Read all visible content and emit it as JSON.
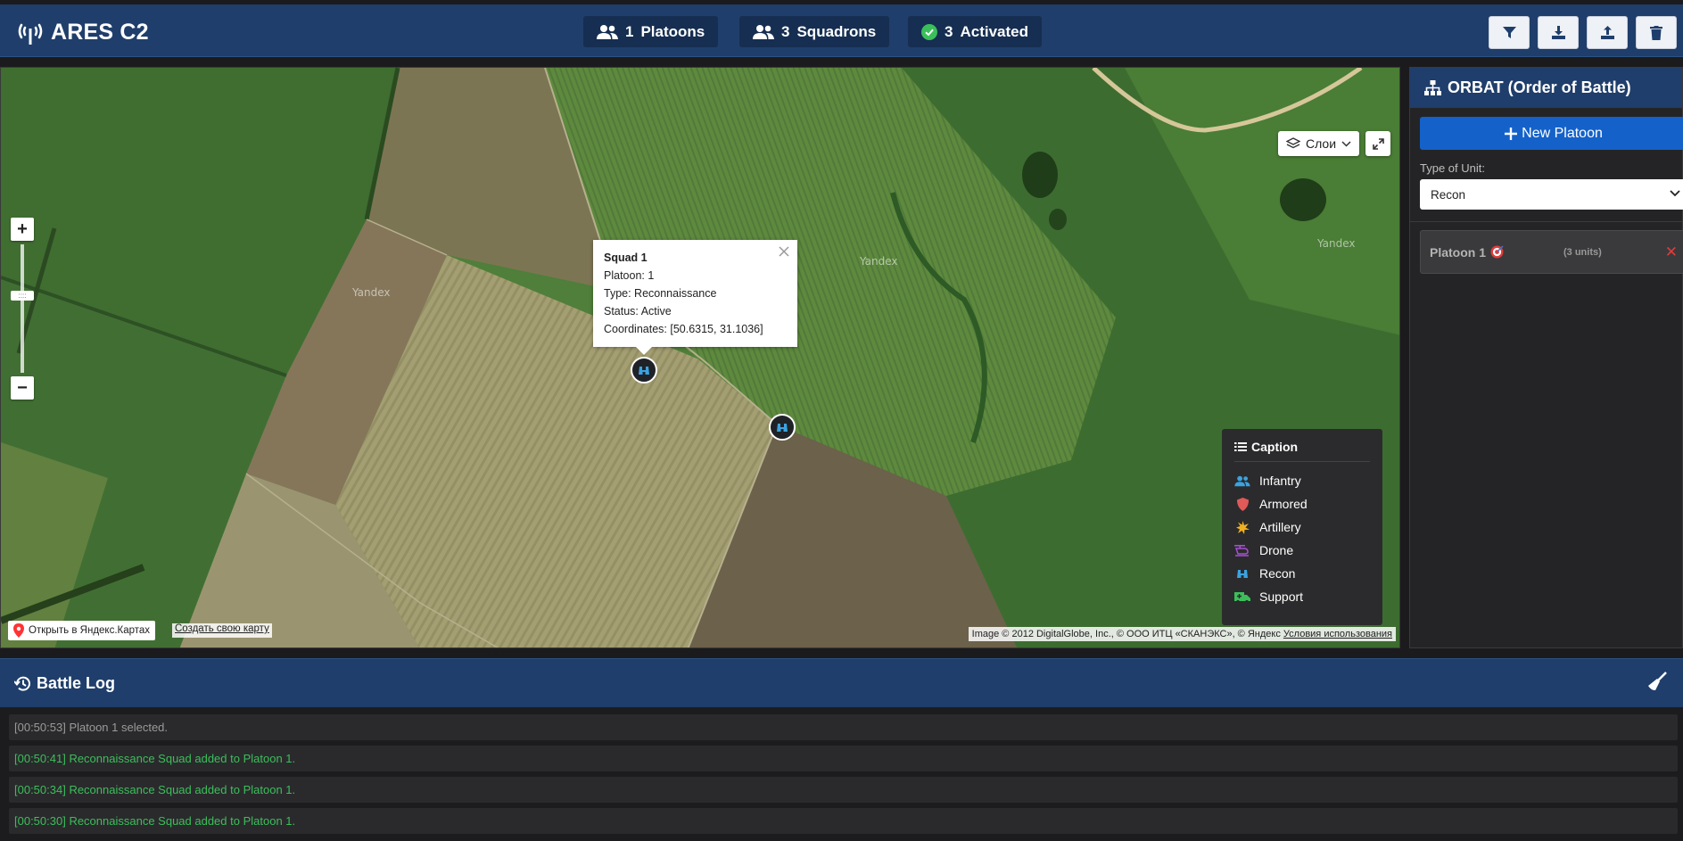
{
  "app": {
    "title": "ARES C2"
  },
  "header": {
    "stats": [
      {
        "value": "1",
        "label": "Platoons"
      },
      {
        "value": "3",
        "label": "Squadrons"
      },
      {
        "value": "3",
        "label": "Activated"
      }
    ],
    "actions": [
      "filter-icon",
      "download-icon",
      "upload-icon",
      "trash-icon"
    ]
  },
  "map": {
    "layers_label": "Слои",
    "watermark": "Yandex",
    "popup": {
      "title": "Squad 1",
      "platoon": "Platoon: 1",
      "type": "Type: Reconnaissance",
      "status": "Status: Active",
      "coordinates": "Coordinates: [50.6315, 31.1036]"
    },
    "caption": {
      "title": "Caption",
      "items": [
        {
          "label": "Infantry",
          "icon": "users-icon",
          "color": "#3ba3e0"
        },
        {
          "label": "Armored",
          "icon": "shield-icon",
          "color": "#e05a5a"
        },
        {
          "label": "Artillery",
          "icon": "burst-icon",
          "color": "#f0b020"
        },
        {
          "label": "Drone",
          "icon": "helicopter-icon",
          "color": "#a64fd0"
        },
        {
          "label": "Recon",
          "icon": "binoculars-icon",
          "color": "#3ba3e0"
        },
        {
          "label": "Support",
          "icon": "ambulance-icon",
          "color": "#3bbf5a"
        }
      ]
    },
    "open_in_yandex": "Открыть в Яндекс.Картах",
    "create_map": "Создать свою карту",
    "copyright": "Image © 2012 DigitalGlobe, Inc., © ООО ИТЦ «СКАНЭКС», © Яндекс",
    "terms": "Условия использования"
  },
  "sidebar": {
    "title": "ORBAT (Order of Battle)",
    "new_platoon": "New Platoon",
    "type_label": "Type of Unit:",
    "type_value": "Recon",
    "platoons": [
      {
        "name": "Platoon 1",
        "units": "(3 units)",
        "remove": "✕"
      }
    ]
  },
  "battle_log": {
    "title": "Battle Log",
    "entries": [
      {
        "text": "[00:50:53] Platoon 1 selected.",
        "kind": "info"
      },
      {
        "text": "[00:50:41] Reconnaissance Squad added to Platoon 1.",
        "kind": "success"
      },
      {
        "text": "[00:50:34] Reconnaissance Squad added to Platoon 1.",
        "kind": "success"
      },
      {
        "text": "[00:50:30] Reconnaissance Squad added to Platoon 1.",
        "kind": "success"
      }
    ]
  },
  "colors": {
    "header_bg": "#1f3e6b",
    "primary_button": "#1462c9",
    "success": "#3bbf5a",
    "danger": "#e23b3b"
  }
}
